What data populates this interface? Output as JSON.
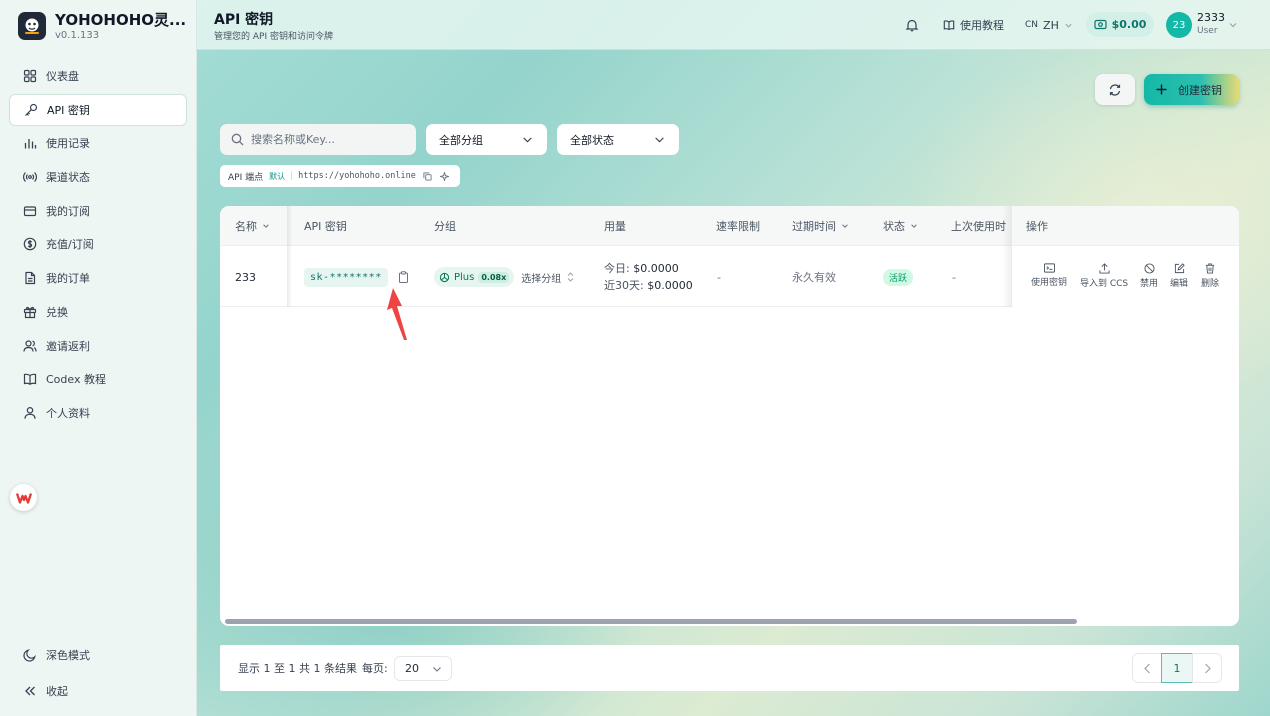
{
  "sidebar": {
    "brand_name": "YOHOHOHO灵...",
    "version": "v0.1.133",
    "items": [
      {
        "label": "仪表盘",
        "icon": "dashboard-grid-icon",
        "active": false
      },
      {
        "label": "API 密钥",
        "icon": "key-icon",
        "active": true
      },
      {
        "label": "使用记录",
        "icon": "bar-chart-icon",
        "active": false
      },
      {
        "label": "渠道状态",
        "icon": "signal-icon",
        "active": false
      },
      {
        "label": "我的订阅",
        "icon": "credit-card-icon",
        "active": false
      },
      {
        "label": "充值/订阅",
        "icon": "dollar-circle-icon",
        "active": false
      },
      {
        "label": "我的订单",
        "icon": "document-icon",
        "active": false
      },
      {
        "label": "兑换",
        "icon": "gift-icon",
        "active": false
      },
      {
        "label": "邀请返利",
        "icon": "users-icon",
        "active": false
      },
      {
        "label": "Codex 教程",
        "icon": "book-icon",
        "active": false
      },
      {
        "label": "个人资料",
        "icon": "user-icon",
        "active": false
      }
    ],
    "dark_mode": "深色模式",
    "collapse": "收起"
  },
  "header": {
    "title": "API 密钥",
    "subtitle": "管理您的 API 密钥和访问令牌",
    "tutorial": "使用教程",
    "lang_flag": "CN",
    "lang": "ZH",
    "balance": "$0.00",
    "avatar_text": "23",
    "username": "2333",
    "role": "User"
  },
  "toolbar": {
    "create_label": "创建密钥",
    "search_placeholder": "搜索名称或Key...",
    "group_filter": "全部分组",
    "status_filter": "全部状态"
  },
  "endpoint": {
    "label": "API 端点",
    "tag": "默认",
    "url": "https://yohohoho.online"
  },
  "table": {
    "columns": [
      "名称",
      "API 密钥",
      "分组",
      "用量",
      "速率限制",
      "过期时间",
      "状态",
      "上次使用时间",
      "操作"
    ],
    "rows": [
      {
        "name": "233",
        "key": "sk-********",
        "group": "Plus",
        "multiplier": "0.08x",
        "group_select": "选择分组",
        "usage_today_label": "今日:",
        "usage_today": "$0.0000",
        "usage_30d_label": "近30天:",
        "usage_30d": "$0.0000",
        "rate_limit": "-",
        "expires": "永久有效",
        "status": "活跃",
        "last_used": "-"
      }
    ],
    "actions": [
      "使用密钥",
      "导入到 CCS",
      "禁用",
      "编辑",
      "删除"
    ]
  },
  "footer": {
    "summary": "显示 1 至 1 共 1 条结果",
    "per_page_label": "每页:",
    "per_page": "20",
    "current_page": "1"
  },
  "colors": {
    "accent": "#14b8a6",
    "active_badge": "#059669",
    "annotation_arrow": "#ef4444"
  }
}
